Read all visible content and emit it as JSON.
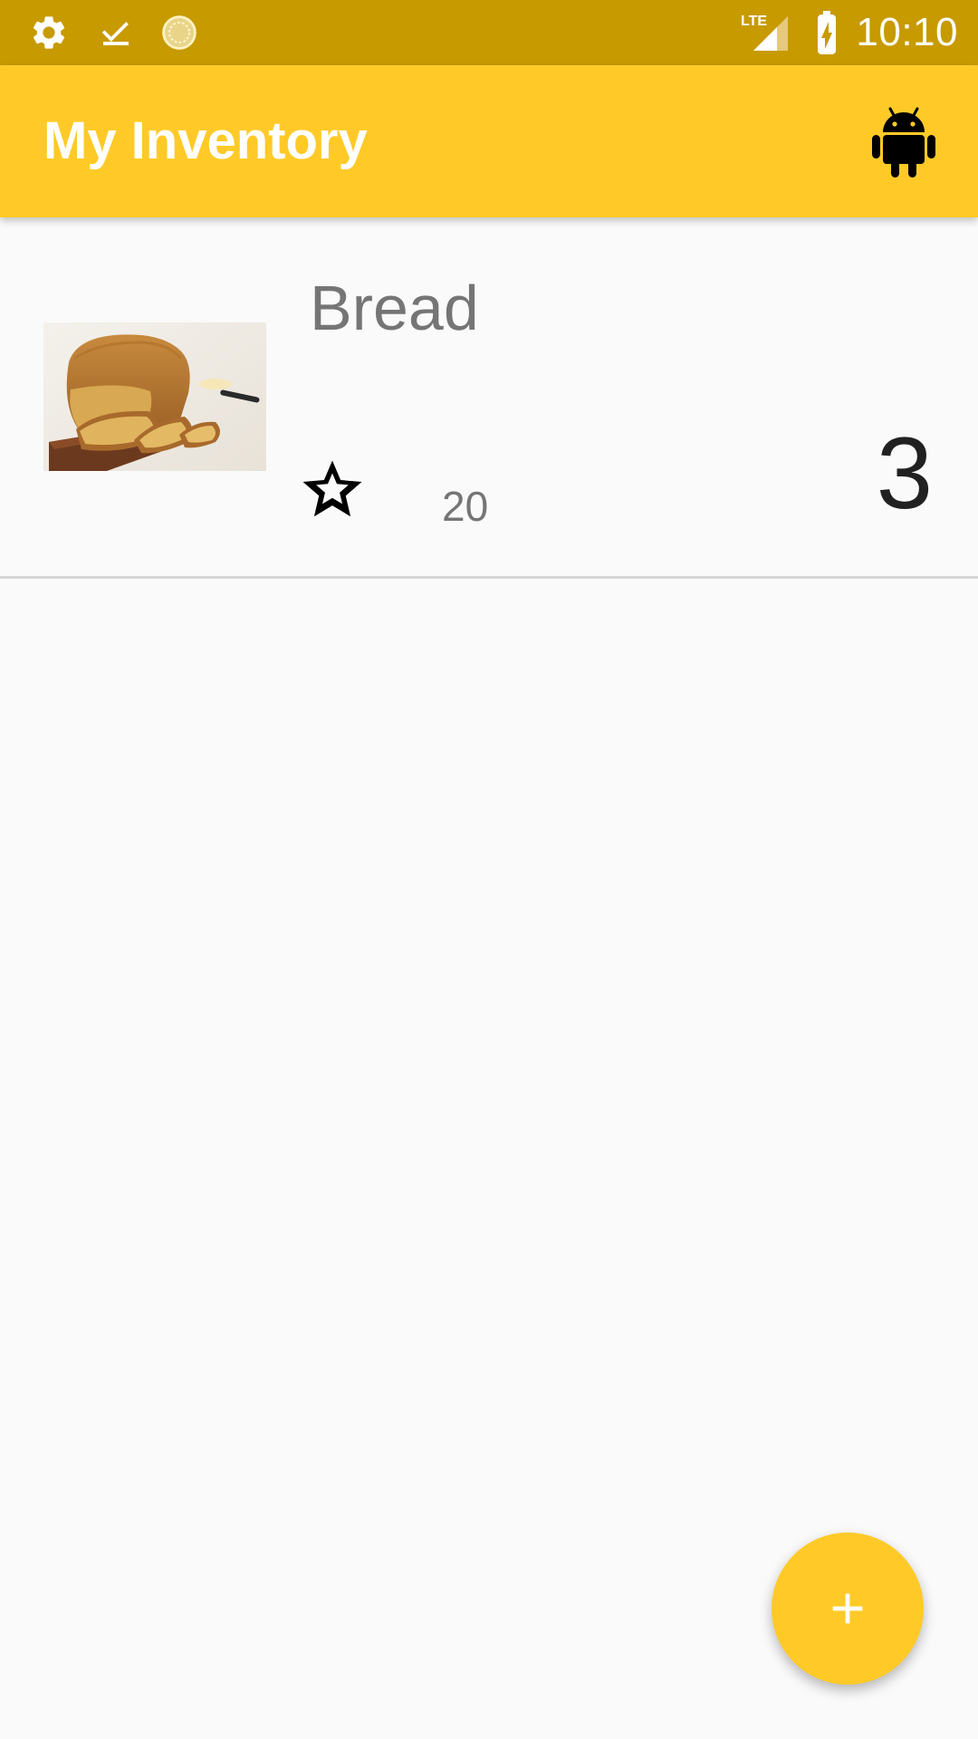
{
  "status_bar": {
    "time": "10:10",
    "network": "LTE",
    "icons": [
      "settings-icon",
      "download-done-icon",
      "sync-circle-icon",
      "lte-signal-icon",
      "battery-charging-icon"
    ]
  },
  "app_bar": {
    "title": "My Inventory",
    "action_icon": "android-icon"
  },
  "items": [
    {
      "name": "Bread",
      "price": "20",
      "quantity": "3",
      "favorite_icon": "star-outline-icon",
      "image": "bread-photo"
    }
  ],
  "fab": {
    "icon": "plus-icon"
  },
  "colors": {
    "status_bar": "#c79a00",
    "primary": "#ffca28",
    "background": "#fafafa",
    "secondary_text": "#757575",
    "primary_text": "#212121"
  }
}
